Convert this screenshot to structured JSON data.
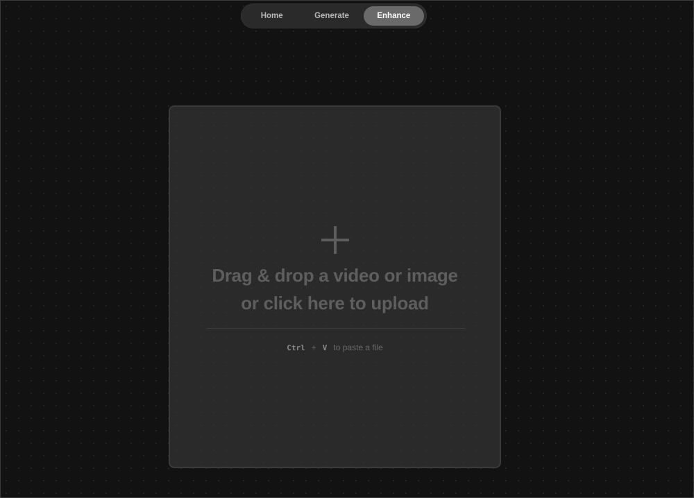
{
  "nav": {
    "tabs": [
      {
        "label": "Home",
        "active": false
      },
      {
        "label": "Generate",
        "active": false
      },
      {
        "label": "Enhance",
        "active": true
      }
    ]
  },
  "upload": {
    "icon": "plus-icon",
    "line1": "Drag & drop a video or image",
    "line2": "or click here to upload",
    "paste_hint": {
      "key1": "Ctrl",
      "plus": "+",
      "key2": "V",
      "text": "to paste a file"
    }
  },
  "colors": {
    "background": "#121212",
    "panel": "#2a2a2a",
    "active_tab": "#6a6a6a",
    "muted_text": "#5e5e5e"
  }
}
